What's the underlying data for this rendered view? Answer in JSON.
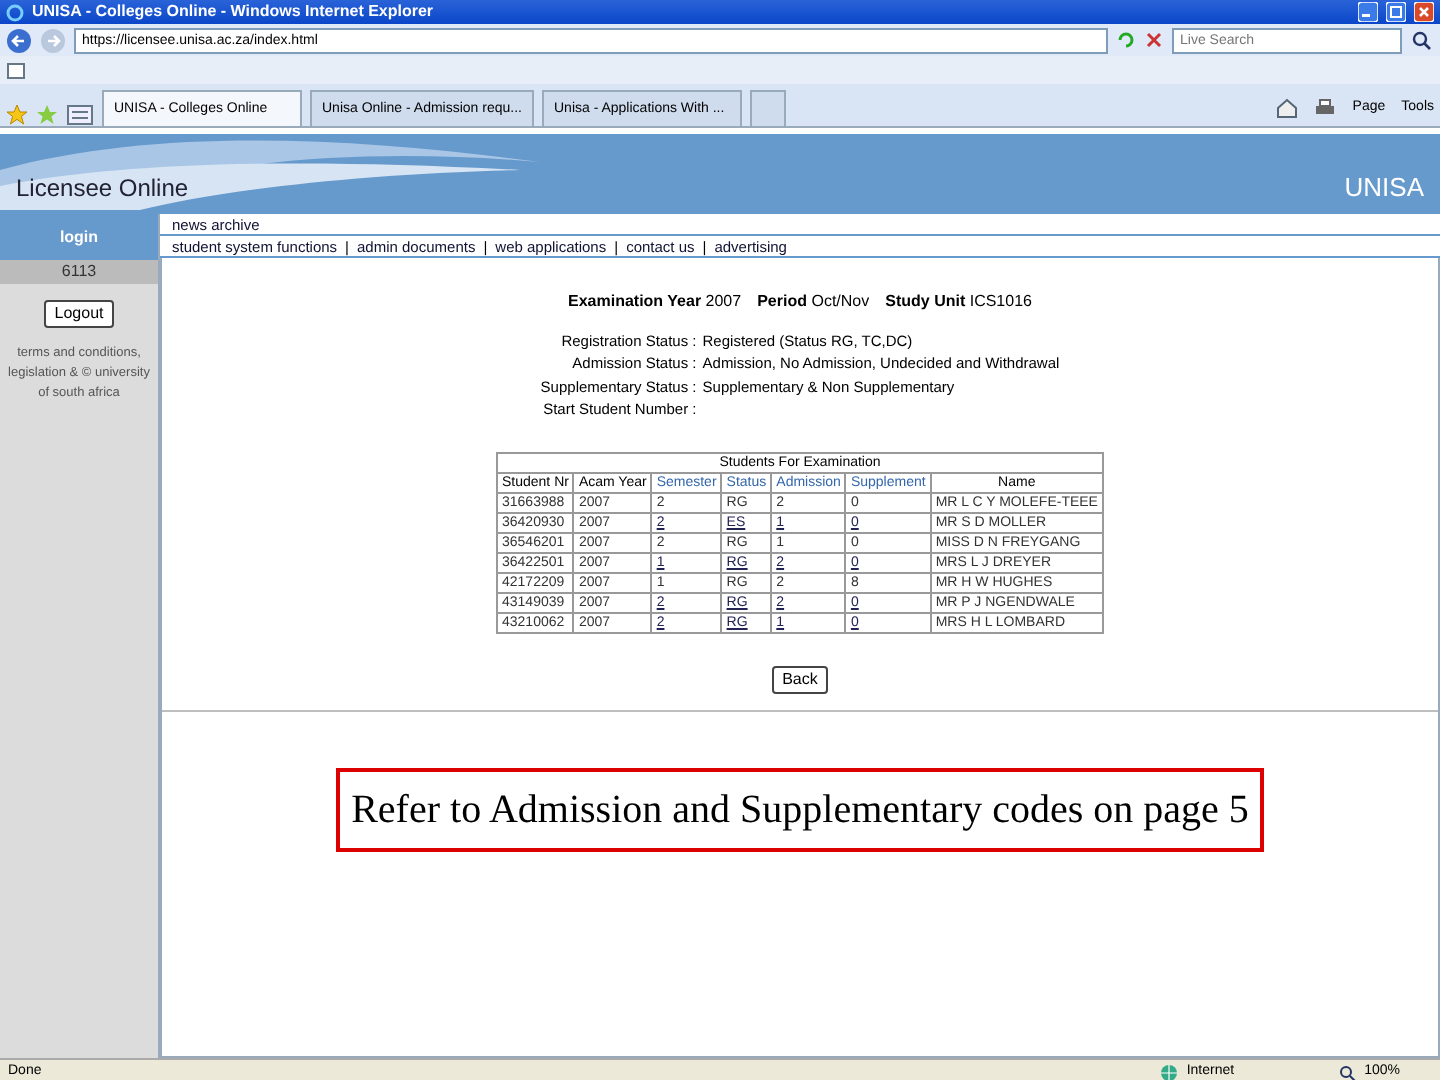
{
  "window": {
    "title": "UNISA - Colleges Online - Windows Internet Explorer"
  },
  "address_bar": {
    "url": "https://licensee.unisa.ac.za/index.html",
    "search_placeholder": "Live Search"
  },
  "tabs": [
    {
      "label": "UNISA - Colleges Online",
      "selected": true
    },
    {
      "label": "Unisa Online - Admission requ...",
      "selected": false
    },
    {
      "label": "Unisa - Applications With ...",
      "selected": false
    }
  ],
  "toolbar": [
    "Page",
    "Tools"
  ],
  "banner": {
    "title": "Licensee Online",
    "logo": "UNISA"
  },
  "sidebar": {
    "header": "login",
    "user": "6113",
    "logout": "Logout",
    "footer": "terms and conditions, legislation & © university of south africa"
  },
  "nav": {
    "top": [
      "news archive"
    ],
    "separator": "|",
    "links": [
      "student system functions",
      "admin documents",
      "web applications",
      "contact us",
      "advertising"
    ]
  },
  "query": [
    {
      "label": "Examination Year",
      "value": "2007"
    },
    {
      "label": "Period",
      "value": "Oct/Nov"
    },
    {
      "label": "Study Unit",
      "value": "ICS1016"
    }
  ],
  "statuses": [
    {
      "label": "Registration Status :",
      "value": "Registered (Status RG, TC,DC)"
    },
    {
      "label": "Admission Status :",
      "value": "Admission, No Admission, Undecided and Withdrawal"
    },
    {
      "label": "Supplementary Status :",
      "value": "Supplementary & Non Supplementary"
    },
    {
      "label": "Start Student Number :"
    }
  ],
  "table": {
    "title": "Students For Examination",
    "columns": [
      {
        "label": "Student Nr",
        "link": false
      },
      {
        "label": "Acam Year",
        "link": false
      },
      {
        "label": "Semester",
        "link": true
      },
      {
        "label": "Status",
        "link": true
      },
      {
        "label": "Admission",
        "link": true
      },
      {
        "label": "Supplement",
        "link": true
      },
      {
        "label": "Name",
        "link": false
      }
    ],
    "rows": [
      {
        "linked": false,
        "cells": [
          "31663988",
          "2007",
          "2",
          "RG",
          "2",
          "0",
          "MR L C Y MOLEFE-TEEE"
        ]
      },
      {
        "linked": true,
        "cells": [
          "36420930",
          "2007",
          "2",
          "ES",
          "1",
          "0",
          "MR S D MOLLER"
        ]
      },
      {
        "linked": false,
        "cells": [
          "36546201",
          "2007",
          "2",
          "RG",
          "1",
          "0",
          "MISS D N FREYGANG"
        ]
      },
      {
        "linked": true,
        "cells": [
          "36422501",
          "2007",
          "1",
          "RG",
          "2",
          "0",
          "MRS L J DREYER"
        ]
      },
      {
        "linked": false,
        "cells": [
          "42172209",
          "2007",
          "1",
          "RG",
          "2",
          "8",
          "MR H W HUGHES"
        ]
      },
      {
        "linked": true,
        "cells": [
          "43149039",
          "2007",
          "2",
          "RG",
          "2",
          "0",
          "MR P J NGENDWALE"
        ]
      },
      {
        "linked": true,
        "cells": [
          "43210062",
          "2007",
          "2",
          "RG",
          "1",
          "0",
          "MRS H L LOMBARD"
        ]
      }
    ]
  },
  "back_button": "Back",
  "caption": "Refer to Admission and Supplementary codes on page 5",
  "status_bar": {
    "text": "Done",
    "zone": "Internet",
    "zoom": "100%"
  }
}
